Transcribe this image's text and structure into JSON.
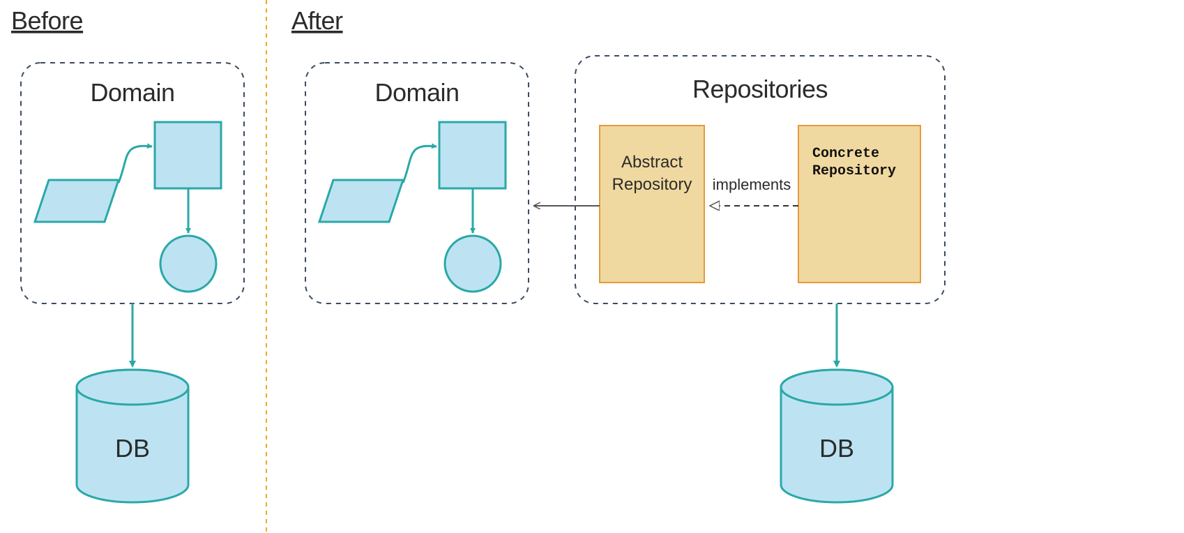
{
  "headings": {
    "before": "Before",
    "after": "After"
  },
  "modules": {
    "domain_before": "Domain",
    "domain_after": "Domain",
    "repositories": "Repositories"
  },
  "repos": {
    "abstract_line1": "Abstract",
    "abstract_line2": "Repository",
    "concrete_line1": "Concrete",
    "concrete_line2": "Repository",
    "implements": "implements"
  },
  "db": {
    "before": "DB",
    "after": "DB"
  },
  "colors": {
    "dashed_border": "#3b4a61",
    "divider": "#f5a623",
    "teal_stroke": "#2aa8a8",
    "blue_fill": "#bde3f2",
    "blue_stroke": "#2aa8a8",
    "box_fill": "#f0d9a0",
    "box_stroke": "#e59a3c",
    "arrow_gray": "#555555"
  }
}
